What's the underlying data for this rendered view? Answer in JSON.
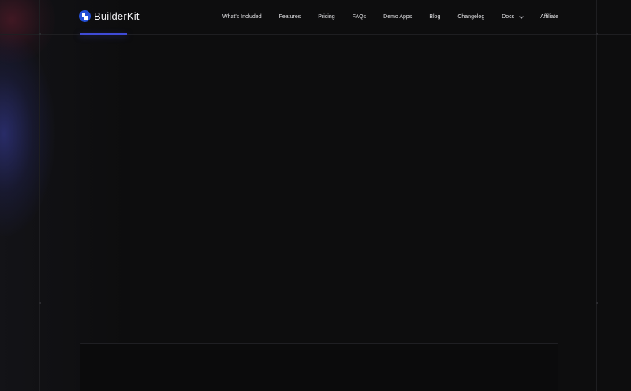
{
  "brand": {
    "name": "BuilderKit",
    "logo_icon": "builderkit-logo-icon",
    "accent_color": "#2450d6",
    "underline_color": "#3f4bd8"
  },
  "nav": {
    "items": [
      {
        "label": "What's Included"
      },
      {
        "label": "Features"
      },
      {
        "label": "Pricing"
      },
      {
        "label": "FAQs"
      },
      {
        "label": "Demo Apps"
      },
      {
        "label": "Blog"
      },
      {
        "label": "Changelog"
      },
      {
        "label": "Docs",
        "icon": "chevron-down-icon"
      },
      {
        "label": "Affiliate"
      }
    ]
  },
  "theme": {
    "background": "#0d0d0e",
    "grid_line": "#1e1e21",
    "text": "#e4e4e7"
  }
}
